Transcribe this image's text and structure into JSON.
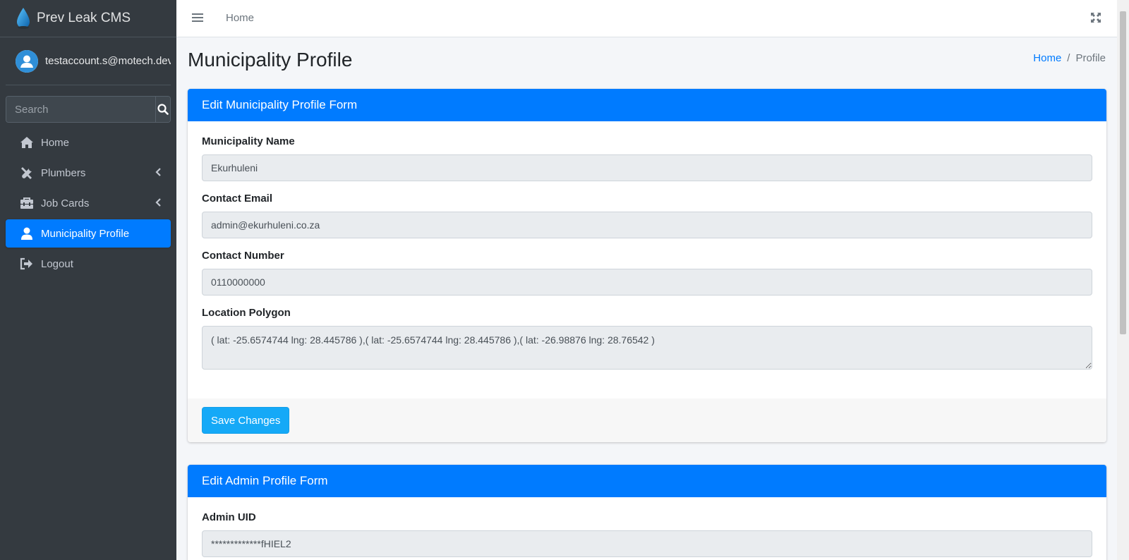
{
  "app": {
    "brand": "Prev Leak CMS"
  },
  "user": {
    "email": "testaccount.s@motech.dev"
  },
  "search": {
    "placeholder": "Search"
  },
  "sidebar": {
    "items": [
      {
        "label": "Home",
        "icon": "home-icon"
      },
      {
        "label": "Plumbers",
        "icon": "tools-icon"
      },
      {
        "label": "Job Cards",
        "icon": "toolbox-icon"
      },
      {
        "label": "Municipality Profile",
        "icon": "user-icon"
      },
      {
        "label": "Logout",
        "icon": "logout-icon"
      }
    ]
  },
  "topbar": {
    "home": "Home"
  },
  "page": {
    "title": "Municipality Profile",
    "breadcrumb": {
      "home": "Home",
      "separator": "/",
      "current": "Profile"
    }
  },
  "municipality_form": {
    "header": "Edit Municipality Profile Form",
    "fields": {
      "name": {
        "label": "Municipality Name",
        "value": "Ekurhuleni"
      },
      "email": {
        "label": "Contact Email",
        "value": "admin@ekurhuleni.co.za"
      },
      "number": {
        "label": "Contact Number",
        "value": "0110000000"
      },
      "polygon": {
        "label": "Location Polygon",
        "value": "( lat: -25.6574744 lng: 28.445786 ),( lat: -25.6574744 lng: 28.445786 ),( lat: -26.98876 lng: 28.76542 )"
      }
    },
    "save_label": "Save Changes"
  },
  "admin_form": {
    "header": "Edit Admin Profile Form",
    "fields": {
      "uid": {
        "label": "Admin UID",
        "value": "*************fHIEL2"
      }
    }
  },
  "colors": {
    "primary": "#007bff",
    "sidebar_bg": "#343a40",
    "button": "#15a9f7"
  }
}
